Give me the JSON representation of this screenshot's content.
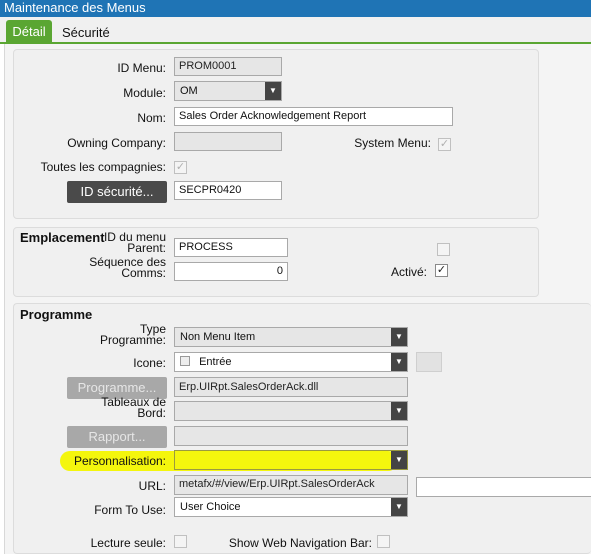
{
  "window": {
    "title": "Maintenance des Menus"
  },
  "tabs": [
    {
      "label": "Détail"
    },
    {
      "label": "Sécurité"
    }
  ],
  "menu": {
    "id_menu_label": "ID Menu:",
    "id_menu_value": "PROM0001",
    "module_label": "Module:",
    "module_value": "OM",
    "nom_label": "Nom:",
    "nom_value": "Sales Order Acknowledgement Report",
    "owning_company_label": "Owning Company:",
    "owning_company_value": "",
    "system_menu_label": "System Menu:",
    "system_menu_checked": true,
    "toutes_compagnies_label": "Toutes les compagnies:",
    "toutes_compagnies_checked": true,
    "id_securite_button": "ID sécurité...",
    "id_securite_value": "SECPR0420"
  },
  "emplacement": {
    "title": "Emplacement",
    "id_parent_label_1": "ID du menu",
    "id_parent_label_2": "Parent:",
    "id_parent_value": "PROCESS",
    "sequence_label_1": "Séquence des",
    "sequence_label_2": "Comms:",
    "sequence_value": "0",
    "active_label": "Activé:",
    "active_checked": true
  },
  "programme": {
    "title": "Programme",
    "type_label_1": "Type",
    "type_label_2": "Programme:",
    "type_value": "Non Menu Item",
    "icone_label": "Icone:",
    "icone_value": "Entrée",
    "programme_button": "Programme...",
    "programme_value": "Erp.UIRpt.SalesOrderAck.dll",
    "tableaux_label_1": "Tableaux de",
    "tableaux_label_2": "Bord:",
    "tableaux_value": "",
    "rapport_button": "Rapport...",
    "rapport_value": "",
    "personnalisation_label": "Personnalisation:",
    "personnalisation_value": "",
    "url_label": "URL:",
    "url_value": "metafx/#/view/Erp.UIRpt.SalesOrderAck",
    "url_extra_value": "",
    "form_to_use_label": "Form To Use:",
    "form_to_use_value": "User Choice",
    "lecture_seule_label": "Lecture seule:",
    "lecture_seule_checked": false,
    "show_web_nav_label": "Show Web Navigation Bar:",
    "show_web_nav_checked": false
  },
  "colors": {
    "titlebar": "#1f74b5",
    "tab_active": "#5aa632",
    "highlight": "#f3f500"
  }
}
